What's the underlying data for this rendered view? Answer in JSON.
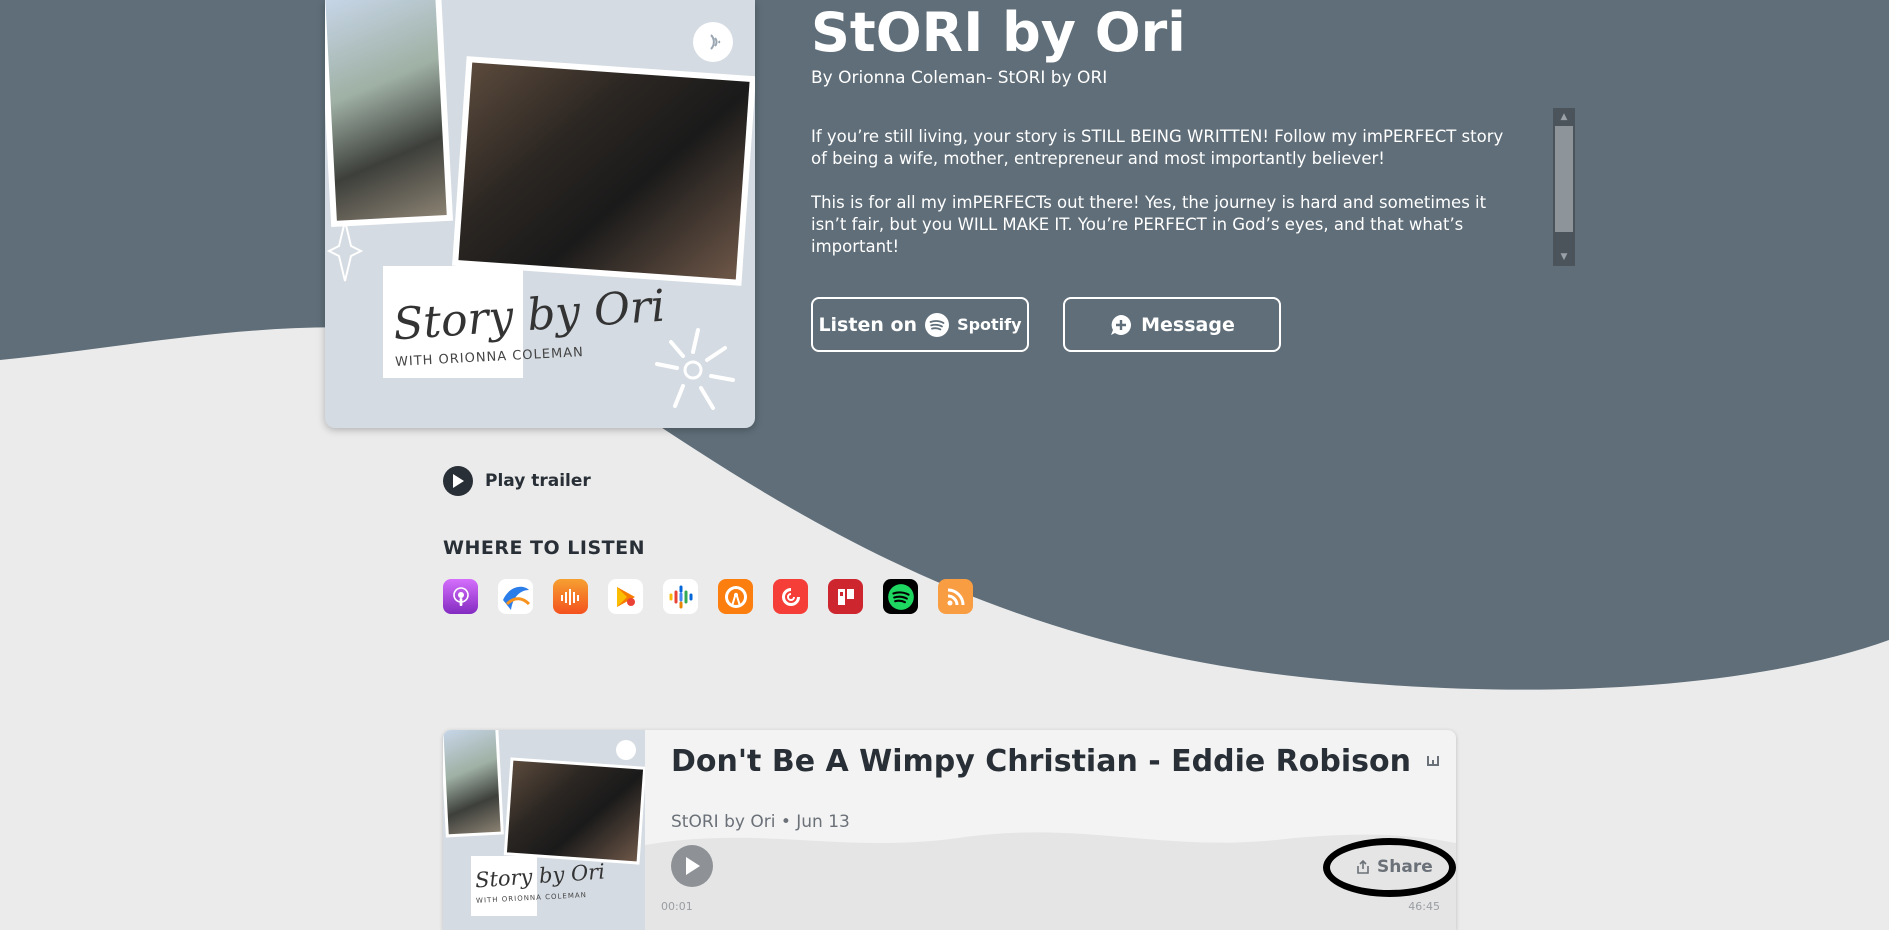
{
  "podcast": {
    "title": "StORI by Ori",
    "byline": "By Orionna Coleman- StORI by ORI",
    "description": [
      "If you’re still living, your story is STILL BEING WRITTEN! Follow my imPERFECT story of being a wife, mother, entrepreneur and most importantly believer!",
      "This is for all my imPERFECTs out there! Yes, the journey is hard and sometimes it isn’t fair, but you WILL MAKE IT. You’re PERFECT in God’s eyes, and that what’s important!"
    ],
    "cover_text": {
      "title": "Story by Ori",
      "subtitle": "WITH ORIONNA COLEMAN"
    }
  },
  "buttons": {
    "listen_on": "Listen on",
    "spotify": "Spotify",
    "message": "Message"
  },
  "trailer": {
    "label": "Play trailer"
  },
  "where_to_listen": {
    "heading": "WHERE TO LISTEN",
    "platforms": [
      {
        "name": "apple-podcasts-icon",
        "color": "#b150e2"
      },
      {
        "name": "castbox-icon",
        "color": "#ffffff"
      },
      {
        "name": "castbox-orange-icon",
        "color": "#f55b23"
      },
      {
        "name": "google-play-icon",
        "color": "#ffffff"
      },
      {
        "name": "google-podcasts-icon",
        "color": "#ffffff"
      },
      {
        "name": "overcast-icon",
        "color": "#fc7e0f"
      },
      {
        "name": "pocket-casts-icon",
        "color": "#f43e37"
      },
      {
        "name": "radio-public-icon",
        "color": "#ce262f"
      },
      {
        "name": "spotify-icon",
        "color": "#000000"
      },
      {
        "name": "rss-icon",
        "color": "#f99d43"
      }
    ]
  },
  "episode": {
    "title": "Don't Be A Wimpy Christian - Eddie Robison",
    "show": "StORI by Ori",
    "date": "Jun 13",
    "share_label": "Share",
    "time_start": "00:01",
    "time_end": "46:45",
    "cover_text": {
      "title": "Story by Ori",
      "subtitle": "WITH ORIONNA COLEMAN"
    }
  },
  "colors": {
    "header_bg": "#5f6e79",
    "page_bg": "#ebebeb",
    "text_dark": "#292f36"
  }
}
